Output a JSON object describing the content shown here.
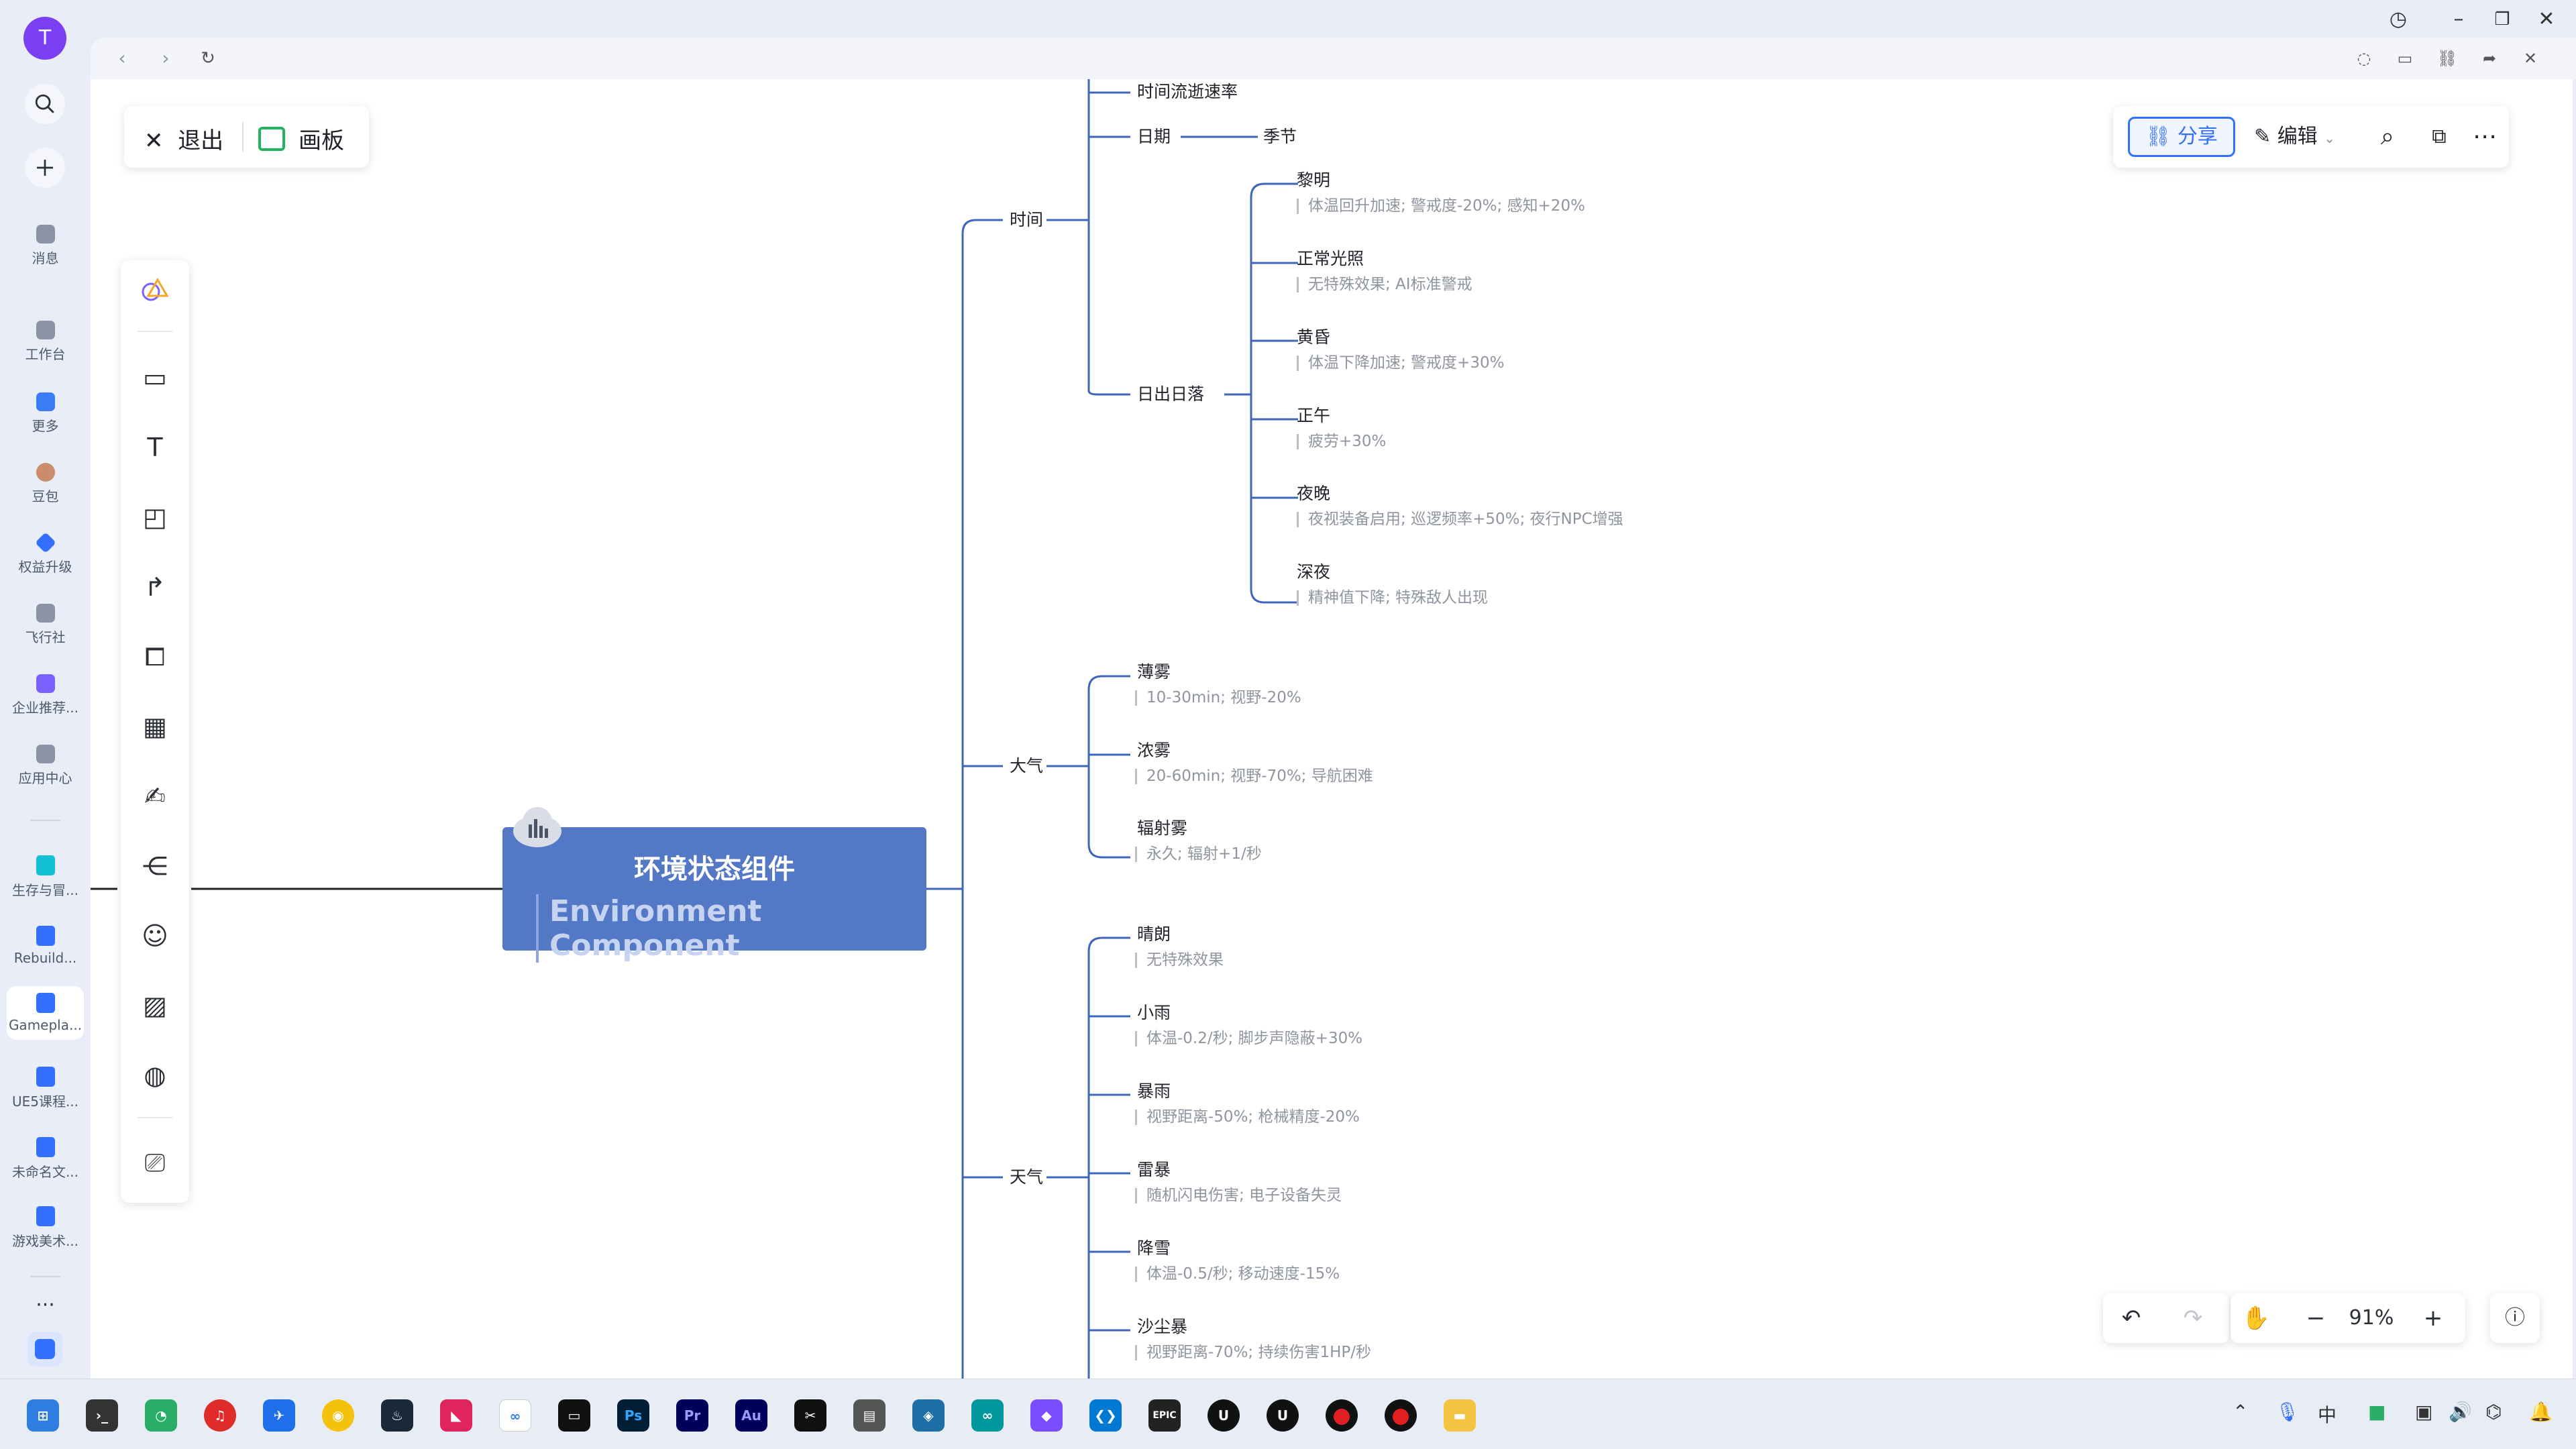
{
  "rail": {
    "avatar_letter": "T",
    "items": [
      {
        "label": "消息"
      },
      {
        "label": "工作台"
      },
      {
        "label": "更多"
      },
      {
        "label": "豆包"
      },
      {
        "label": "权益升级"
      },
      {
        "label": "飞行社"
      },
      {
        "label": "企业推荐..."
      },
      {
        "label": "应用中心"
      },
      {
        "label": "生存与冒..."
      },
      {
        "label": "Rebuild..."
      },
      {
        "label": "Gamepla..."
      },
      {
        "label": "UE5课程..."
      },
      {
        "label": "未命名文..."
      },
      {
        "label": "游戏美术..."
      }
    ],
    "more_label": "···"
  },
  "toolbar": {
    "exit_label": "退出",
    "board_label": "画板",
    "share_label": "分享",
    "edit_label": "编辑"
  },
  "zoom": {
    "value": "91%"
  },
  "mindmap": {
    "root": {
      "title": "环境状态组件",
      "subtitle": "Environment Component"
    },
    "branches": {
      "time": "时间",
      "atmosphere": "大气",
      "weather": "天气"
    },
    "time": {
      "flow_rate": "时间流逝速率",
      "date": "日期",
      "season": "季节",
      "sunrise_sunset": "日出日落",
      "phases": [
        {
          "name": "黎明",
          "note": "体温回升加速; 警戒度-20%; 感知+20%"
        },
        {
          "name": "正常光照",
          "note": "无特殊效果; AI标准警戒"
        },
        {
          "name": "黄昏",
          "note": "体温下降加速; 警戒度+30%"
        },
        {
          "name": "正午",
          "note": "疲劳+30%"
        },
        {
          "name": "夜晚",
          "note": "夜视装备启用; 巡逻频率+50%; 夜行NPC增强"
        },
        {
          "name": "深夜",
          "note": "精神值下降; 特殊敌人出现"
        }
      ]
    },
    "atmosphere": [
      {
        "name": "薄雾",
        "note": "10-30min; 视野-20%"
      },
      {
        "name": "浓雾",
        "note": "20-60min; 视野-70%; 导航困难"
      },
      {
        "name": "辐射雾",
        "note": "永久; 辐射+1/秒"
      }
    ],
    "weather": [
      {
        "name": "晴朗",
        "note": "无特殊效果"
      },
      {
        "name": "小雨",
        "note": "体温-0.2/秒; 脚步声隐蔽+30%"
      },
      {
        "name": "暴雨",
        "note": "视野距离-50%; 枪械精度-20%"
      },
      {
        "name": "雷暴",
        "note": "随机闪电伤害; 电子设备失灵"
      },
      {
        "name": "降雪",
        "note": "体温-0.5/秒; 移动速度-15%"
      },
      {
        "name": "沙尘暴",
        "note": "视野距离-70%; 持续伤害1HP/秒"
      }
    ]
  },
  "taskbar": {
    "apps": [
      "Ps",
      "Pr",
      "Au",
      "EPIC"
    ],
    "ime": "中"
  },
  "colors": {
    "root_fill": "#5378c5",
    "branch_line": "#3f66b8",
    "accent": "#3370ff"
  }
}
